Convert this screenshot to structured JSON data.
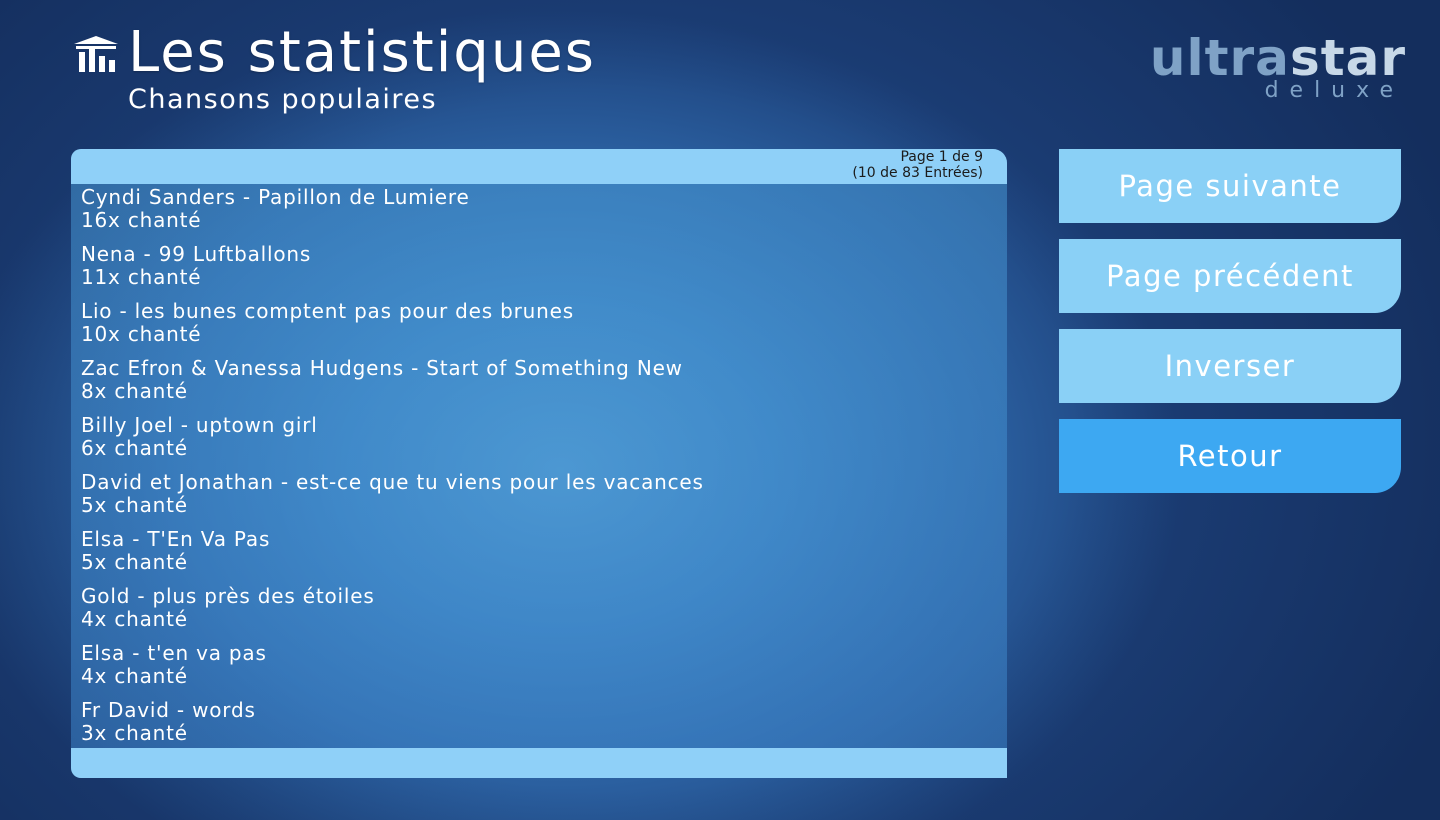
{
  "header": {
    "title": "Les statistiques",
    "subtitle": "Chansons populaires",
    "icon": "stats-chart-icon"
  },
  "logo": {
    "ultra": "ultra",
    "star": "star",
    "sub": "deluxe"
  },
  "panel": {
    "page_line": "Page 1 de 9",
    "entries_line": "(10 de 83 Entrées)",
    "items": [
      {
        "song": "Cyndi Sanders - Papillon de Lumiere",
        "count": "16x chanté"
      },
      {
        "song": "Nena - 99 Luftballons",
        "count": "11x chanté"
      },
      {
        "song": "Lio - les bunes comptent pas pour des brunes",
        "count": "10x chanté"
      },
      {
        "song": "Zac Efron & Vanessa Hudgens - Start of Something New",
        "count": "8x chanté"
      },
      {
        "song": "Billy Joel - uptown girl",
        "count": "6x chanté"
      },
      {
        "song": "David et Jonathan - est-ce que tu viens pour les vacances",
        "count": "5x chanté"
      },
      {
        "song": "Elsa - T'En Va Pas",
        "count": "5x chanté"
      },
      {
        "song": "Gold - plus près des étoiles",
        "count": "4x chanté"
      },
      {
        "song": "Elsa - t'en va pas",
        "count": "4x chanté"
      },
      {
        "song": "Fr David - words",
        "count": "3x chanté"
      }
    ]
  },
  "buttons": {
    "next": "Page suivante",
    "prev": "Page précédent",
    "reverse": "Inverser",
    "back": "Retour"
  },
  "colors": {
    "button": "#8ad0f6",
    "button_active": "#3da8f2",
    "panel_bar": "#8fd0f8"
  }
}
